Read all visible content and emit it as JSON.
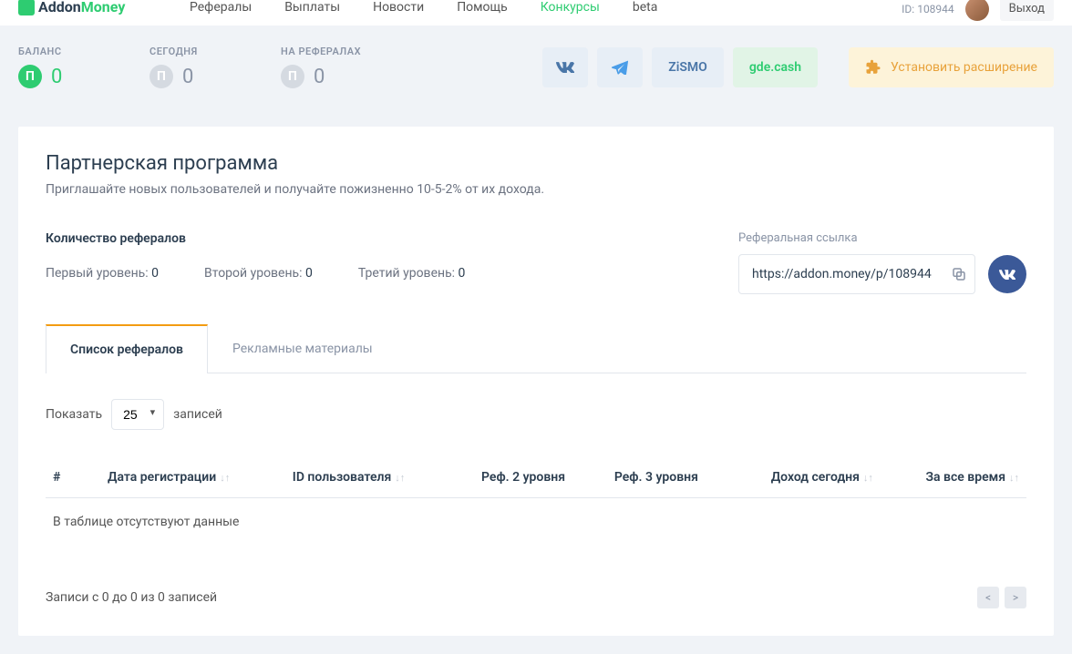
{
  "header": {
    "logo_part1": "Addon",
    "logo_part2": "Money",
    "nav": [
      "Рефералы",
      "Выплаты",
      "Новости",
      "Помощь",
      "Конкурсы",
      "beta"
    ],
    "nav_active_index": 4,
    "user_id_label": "ID: 108944",
    "logout": "Выход"
  },
  "stats": {
    "balance_label": "БАЛАНС",
    "balance_value": "0",
    "today_label": "СЕГОДНЯ",
    "today_value": "0",
    "referrals_label": "НА РЕФЕРАЛАХ",
    "referrals_value": "0",
    "p_symbol": "П"
  },
  "social": {
    "vk": "VK",
    "zismo": "ZiSMO",
    "gdecash": "gde.cash",
    "install": "Установить расширение"
  },
  "card": {
    "title": "Партнерская программа",
    "subtitle": "Приглашайте новых пользователей и получайте пожизненно 10-5-2% от их дохода."
  },
  "referrals": {
    "count_title": "Количество рефералов",
    "level1_label": "Первый уровень:",
    "level1_value": "0",
    "level2_label": "Второй уровень:",
    "level2_value": "0",
    "level3_label": "Третий уровень:",
    "level3_value": "0",
    "link_label": "Реферальная ссылка",
    "link_value": "https://addon.money/p/108944"
  },
  "tabs": {
    "list": "Список рефералов",
    "promo": "Рекламные материалы"
  },
  "table": {
    "show_label": "Показать",
    "entries_label": "записей",
    "page_size": "25",
    "columns": {
      "num": "#",
      "reg_date": "Дата регистрации",
      "user_id": "ID пользователя",
      "ref_l2": "Реф. 2 уровня",
      "ref_l3": "Реф. 3 уровня",
      "today_income": "Доход сегодня",
      "all_time": "За все время"
    },
    "empty": "В таблице отсутствуют данные",
    "footer_info": "Записи с 0 до 0 из 0 записей",
    "prev": "<",
    "next": ">"
  }
}
